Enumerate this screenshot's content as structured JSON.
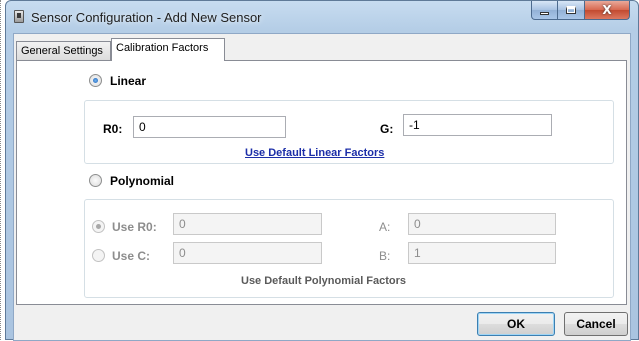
{
  "window": {
    "title": "Sensor Configuration - Add New Sensor",
    "icon": "device-icon"
  },
  "caption_buttons": {
    "minimize_icon": "minimize-icon",
    "maximize_icon": "maximize-icon",
    "close_label": "X"
  },
  "tabs": [
    {
      "label": "General Settings",
      "active": false
    },
    {
      "label": "Calibration Factors",
      "active": true
    }
  ],
  "linear": {
    "label": "Linear",
    "selected": true,
    "r0_label": "R0:",
    "r0_value": "0",
    "g_label": "G:",
    "g_value": "-1",
    "default_link": "Use Default Linear Factors"
  },
  "polynomial": {
    "label": "Polynomial",
    "selected": false,
    "use_r0_label": "Use R0:",
    "use_r0_selected": true,
    "use_r0_value": "0",
    "use_c_label": "Use C:",
    "use_c_selected": false,
    "use_c_value": "0",
    "a_label": "A:",
    "a_value": "0",
    "b_label": "B:",
    "b_value": "1",
    "default_link": "Use Default Polynomial Factors"
  },
  "buttons": {
    "ok": "OK",
    "cancel": "Cancel"
  },
  "colors": {
    "link": "#1c2ea8",
    "title_bar": "#b4cde6",
    "close_button": "#c24a30"
  }
}
